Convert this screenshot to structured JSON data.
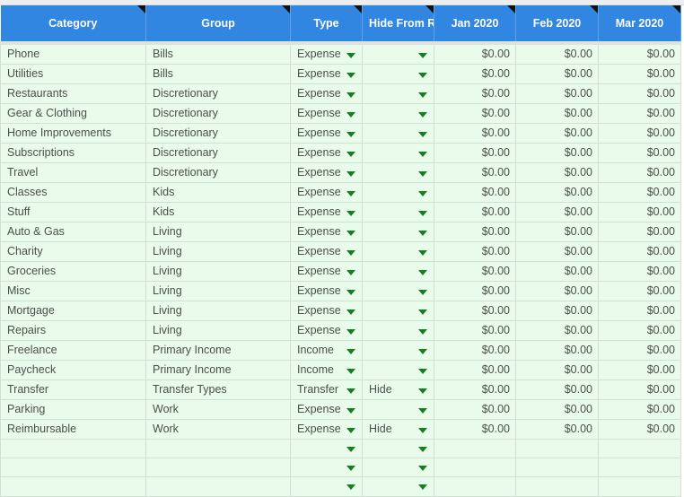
{
  "app": {
    "type": "spreadsheet-table",
    "accent_header_bg": "#3086e0",
    "row_bg": "#e9fbea",
    "grid_line": "#d3ded4",
    "caret_color": "#13801f"
  },
  "table": {
    "columns": [
      {
        "label": "Category",
        "align": "left"
      },
      {
        "label": "Group",
        "align": "left"
      },
      {
        "label": "Type",
        "align": "left"
      },
      {
        "label": "Hide From Reports",
        "align": "left"
      },
      {
        "label": "Jan 2020",
        "align": "center"
      },
      {
        "label": "Feb 2020",
        "align": "center"
      },
      {
        "label": "Mar 2020",
        "align": "center"
      }
    ],
    "rows": [
      {
        "category": "Phone",
        "group": "Bills",
        "type": "Expense",
        "hide": "",
        "jan": "$0.00",
        "feb": "$0.00",
        "mar": "$0.00"
      },
      {
        "category": "Utilities",
        "group": "Bills",
        "type": "Expense",
        "hide": "",
        "jan": "$0.00",
        "feb": "$0.00",
        "mar": "$0.00"
      },
      {
        "category": "Restaurants",
        "group": "Discretionary",
        "type": "Expense",
        "hide": "",
        "jan": "$0.00",
        "feb": "$0.00",
        "mar": "$0.00"
      },
      {
        "category": "Gear & Clothing",
        "group": "Discretionary",
        "type": "Expense",
        "hide": "",
        "jan": "$0.00",
        "feb": "$0.00",
        "mar": "$0.00"
      },
      {
        "category": "Home Improvements",
        "group": "Discretionary",
        "type": "Expense",
        "hide": "",
        "jan": "$0.00",
        "feb": "$0.00",
        "mar": "$0.00"
      },
      {
        "category": "Subscriptions",
        "group": "Discretionary",
        "type": "Expense",
        "hide": "",
        "jan": "$0.00",
        "feb": "$0.00",
        "mar": "$0.00"
      },
      {
        "category": "Travel",
        "group": "Discretionary",
        "type": "Expense",
        "hide": "",
        "jan": "$0.00",
        "feb": "$0.00",
        "mar": "$0.00"
      },
      {
        "category": "Classes",
        "group": "Kids",
        "type": "Expense",
        "hide": "",
        "jan": "$0.00",
        "feb": "$0.00",
        "mar": "$0.00"
      },
      {
        "category": "Stuff",
        "group": "Kids",
        "type": "Expense",
        "hide": "",
        "jan": "$0.00",
        "feb": "$0.00",
        "mar": "$0.00"
      },
      {
        "category": "Auto & Gas",
        "group": "Living",
        "type": "Expense",
        "hide": "",
        "jan": "$0.00",
        "feb": "$0.00",
        "mar": "$0.00"
      },
      {
        "category": "Charity",
        "group": "Living",
        "type": "Expense",
        "hide": "",
        "jan": "$0.00",
        "feb": "$0.00",
        "mar": "$0.00"
      },
      {
        "category": "Groceries",
        "group": "Living",
        "type": "Expense",
        "hide": "",
        "jan": "$0.00",
        "feb": "$0.00",
        "mar": "$0.00"
      },
      {
        "category": "Misc",
        "group": "Living",
        "type": "Expense",
        "hide": "",
        "jan": "$0.00",
        "feb": "$0.00",
        "mar": "$0.00"
      },
      {
        "category": "Mortgage",
        "group": "Living",
        "type": "Expense",
        "hide": "",
        "jan": "$0.00",
        "feb": "$0.00",
        "mar": "$0.00"
      },
      {
        "category": "Repairs",
        "group": "Living",
        "type": "Expense",
        "hide": "",
        "jan": "$0.00",
        "feb": "$0.00",
        "mar": "$0.00"
      },
      {
        "category": "Freelance",
        "group": "Primary Income",
        "type": "Income",
        "hide": "",
        "jan": "$0.00",
        "feb": "$0.00",
        "mar": "$0.00"
      },
      {
        "category": "Paycheck",
        "group": "Primary Income",
        "type": "Income",
        "hide": "",
        "jan": "$0.00",
        "feb": "$0.00",
        "mar": "$0.00"
      },
      {
        "category": "Transfer",
        "group": "Transfer Types",
        "type": "Transfer",
        "hide": "Hide",
        "jan": "$0.00",
        "feb": "$0.00",
        "mar": "$0.00"
      },
      {
        "category": "Parking",
        "group": "Work",
        "type": "Expense",
        "hide": "",
        "jan": "$0.00",
        "feb": "$0.00",
        "mar": "$0.00"
      },
      {
        "category": "Reimbursable",
        "group": "Work",
        "type": "Expense",
        "hide": "Hide",
        "jan": "$0.00",
        "feb": "$0.00",
        "mar": "$0.00"
      },
      {
        "category": "",
        "group": "",
        "type": "",
        "hide": "",
        "jan": "",
        "feb": "",
        "mar": ""
      },
      {
        "category": "",
        "group": "",
        "type": "",
        "hide": "",
        "jan": "",
        "feb": "",
        "mar": ""
      },
      {
        "category": "",
        "group": "",
        "type": "",
        "hide": "",
        "jan": "",
        "feb": "",
        "mar": ""
      }
    ]
  }
}
